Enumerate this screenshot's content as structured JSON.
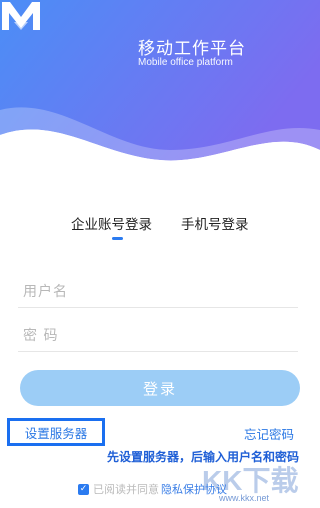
{
  "header": {
    "title": "移动工作平台",
    "subtitle": "Mobile office platform",
    "logo_icon": "m-logo-icon",
    "gradient_start": "#4a8cf5",
    "gradient_end": "#7e6df0"
  },
  "tabs": [
    {
      "label": "企业账号登录",
      "active": true
    },
    {
      "label": "手机号登录",
      "active": false
    }
  ],
  "form": {
    "username_placeholder": "用户名",
    "password_placeholder": "密 码",
    "login_label": "登录"
  },
  "links": {
    "server_settings": "设置服务器",
    "forgot_password": "忘记密码"
  },
  "hint": "先设置服务器，后输入用户名和密码",
  "agreement": {
    "checked": true,
    "text": "已阅读并同意",
    "privacy_label": "隐私保护协议"
  },
  "watermark": {
    "site": "www.kkx.net",
    "logo_text": "KK下载"
  },
  "colors": {
    "accent": "#2b7bf0",
    "button": "#9ccdf6",
    "highlight_box": "#1a6ff0"
  }
}
